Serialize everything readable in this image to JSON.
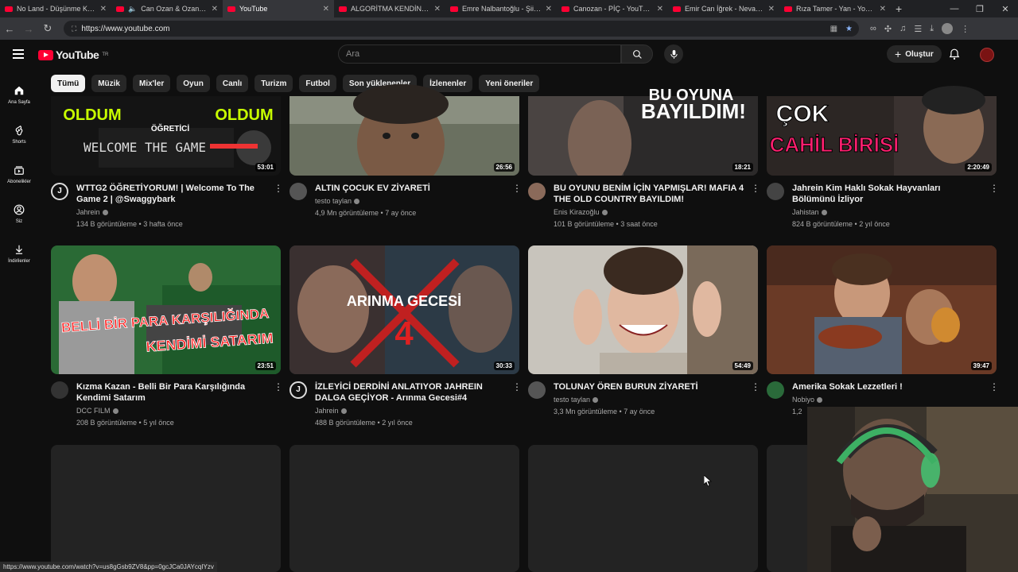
{
  "browser": {
    "tabs": [
      {
        "title": "No Land - Düşünme Kaybol...",
        "active": false,
        "icon": "youtube-icon"
      },
      {
        "title": "Can Ozan & Ozan Buğr...",
        "active": false,
        "icon": "speaker-icon"
      },
      {
        "title": "YouTube",
        "active": true,
        "icon": "youtube-icon"
      },
      {
        "title": "ALGORİTMA KENDİNİ KÖTÜ...",
        "active": false,
        "icon": "youtube-icon"
      },
      {
        "title": "Emre Nalbantoğlu - Şiir Old...",
        "active": false,
        "icon": "youtube-icon"
      },
      {
        "title": "Canozan - PİÇ - YouTube",
        "active": false,
        "icon": "youtube-icon"
      },
      {
        "title": "Emir Can İğrek - Nevale (Offi...",
        "active": false,
        "icon": "youtube-icon"
      },
      {
        "title": "Rıza Tamer - Yan - YouTube",
        "active": false,
        "icon": "youtube-icon"
      }
    ],
    "url": "https://www.youtube.com",
    "status_url": "https://www.youtube.com/watch?v=us8gGsb9ZV8&pp=0gcJCa0JAYcqIYzv"
  },
  "youtube": {
    "logo": "YouTube",
    "region": "TR",
    "search_placeholder": "Ara",
    "create_label": "Oluştur",
    "brand_color": "#ff0033",
    "chips": [
      "Tümü",
      "Müzik",
      "Mix'ler",
      "Oyun",
      "Canlı",
      "Turizm",
      "Futbol",
      "Son yüklenenler",
      "İzlenenler",
      "Yeni öneriler"
    ],
    "selected_chip": "Tümü",
    "sidebar": [
      {
        "label": "Ana Sayfa",
        "icon": "home-icon"
      },
      {
        "label": "Shorts",
        "icon": "shorts-icon"
      },
      {
        "label": "Abonelikler",
        "icon": "subscriptions-icon"
      },
      {
        "label": "Siz",
        "icon": "user-icon"
      },
      {
        "label": "İndirilenler",
        "icon": "download-icon"
      }
    ]
  },
  "videos": [
    {
      "title": "WTTG2 ÖĞRETİYORUM! | Welcome To The Game 2 | @Swaggybark",
      "channel": "Jahrein",
      "meta": "134 B görüntüleme • 3 hafta önce",
      "duration": "53:01",
      "thumb_text": [
        "OLDUM",
        "ÖĞRETİCİ",
        "WELCOME THE GAME",
        "OLDUM"
      ]
    },
    {
      "title": "ALTIN ÇOCUK EV ZİYARETİ",
      "channel": "testo taylan",
      "meta": "4,9 Mn görüntüleme • 7 ay önce",
      "duration": "26:56",
      "thumb_text": []
    },
    {
      "title": "BU OYUNU BENİM İÇİN YAPMIŞLAR! MAFIA 4 THE OLD COUNTRY BAYILDIM!",
      "channel": "Enis Kirazoğlu",
      "meta": "101 B görüntüleme • 3 saat önce",
      "duration": "18:21",
      "thumb_text": [
        "BU OYUNA",
        "BAYILDIM!"
      ]
    },
    {
      "title": "Jahrein Kim Haklı Sokak Hayvanları Bölümünü İzliyor",
      "channel": "Jahistan",
      "meta": "824 B görüntüleme • 2 yıl önce",
      "duration": "2:20:49",
      "thumb_text": [
        "ÇOK",
        "CAHİL BİRİSİ"
      ]
    },
    {
      "title": "Kızma Kazan - Belli Bir Para Karşılığında Kendimi Satarım",
      "channel": "DCC FILM",
      "meta": "208 B görüntüleme • 5 yıl önce",
      "duration": "23:51",
      "thumb_text": [
        "BELLİ BİR PARA KARŞILIĞINDA",
        "KENDİMİ SATARIM"
      ]
    },
    {
      "title": "İZLEYİCİ DERDİNİ ANLATIYOR JAHREIN DALGA GEÇİYOR - Arınma Gecesi#4",
      "channel": "Jahrein",
      "meta": "488 B görüntüleme • 2 yıl önce",
      "duration": "30:33",
      "thumb_text": [
        "ARINMA GECESİ",
        "4"
      ]
    },
    {
      "title": "TOLUNAY ÖREN BURUN ZİYARETİ",
      "channel": "testo taylan",
      "meta": "3,3 Mn görüntüleme • 7 ay önce",
      "duration": "54:49",
      "thumb_text": []
    },
    {
      "title": "Amerika Sokak Lezzetleri !",
      "channel": "Nobiyo",
      "meta": "1,2",
      "duration": "39:47",
      "thumb_text": []
    }
  ]
}
